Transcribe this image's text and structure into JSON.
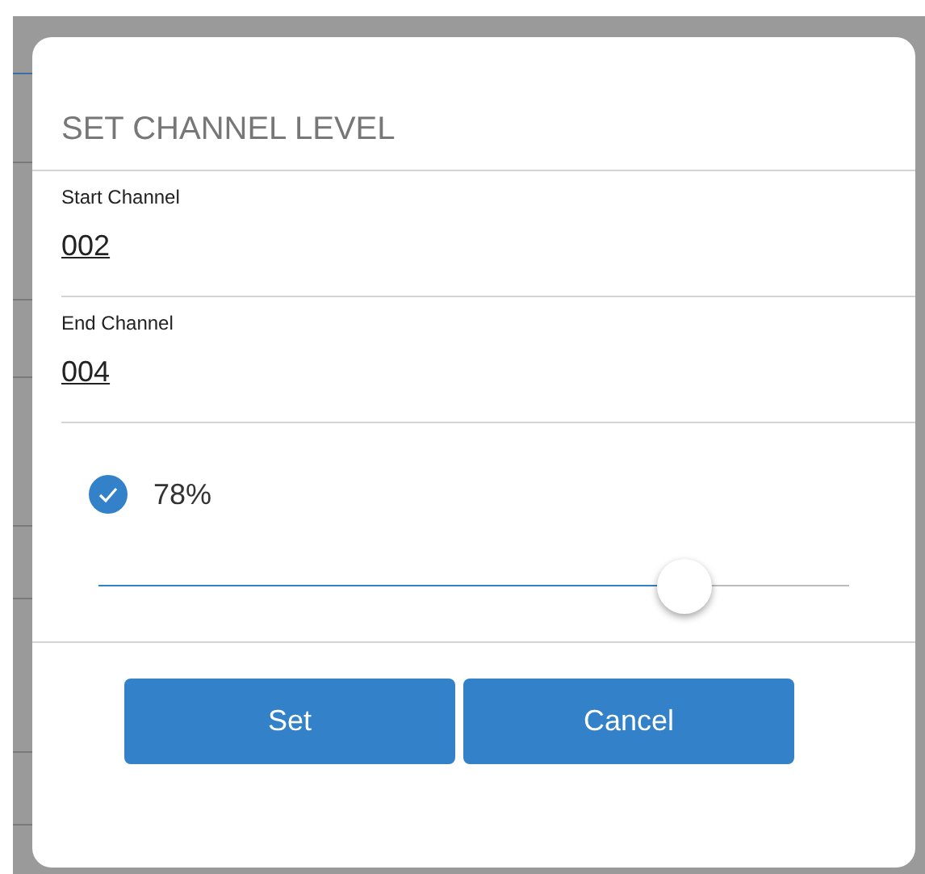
{
  "dialog": {
    "title": "SET CHANNEL LEVEL",
    "fields": [
      {
        "label": "Start Channel",
        "value": "002"
      },
      {
        "label": "End Channel",
        "value": "004"
      }
    ],
    "level_control": {
      "checked": true,
      "reading": "78%",
      "level": 0.78
    },
    "buttons": [
      "Set",
      "Cancel"
    ]
  }
}
